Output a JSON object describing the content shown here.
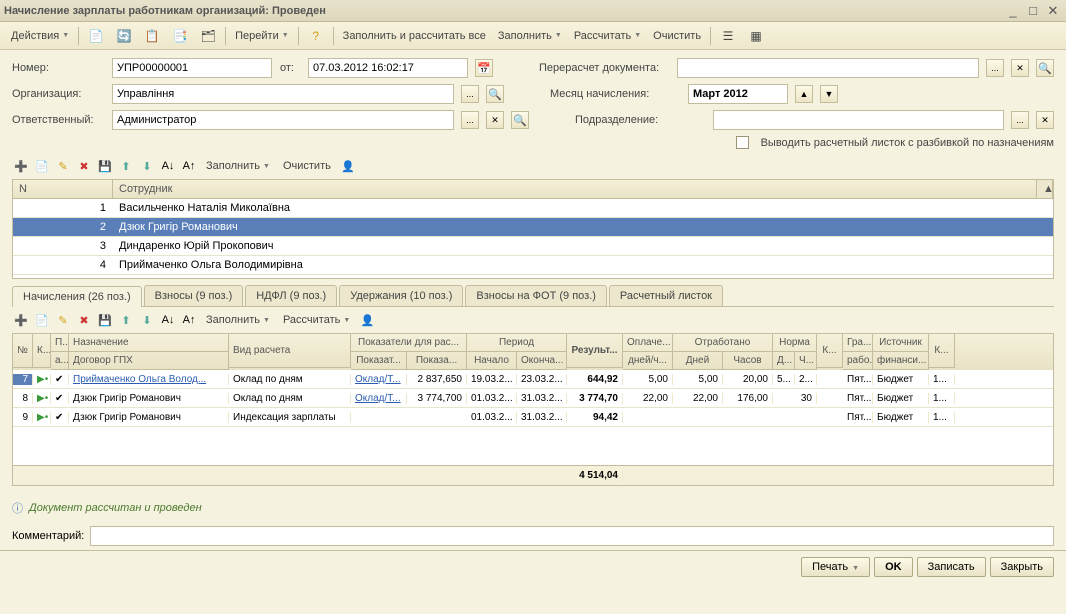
{
  "window_title": "Начисление зарплаты работникам организаций: Проведен",
  "toolbar": {
    "actions": "Действия",
    "go": "Перейти",
    "fill_calc_all": "Заполнить и рассчитать все",
    "fill": "Заполнить",
    "calc": "Рассчитать",
    "clear": "Очистить"
  },
  "form": {
    "number_label": "Номер:",
    "number": "УПР00000001",
    "from_label": "от:",
    "date": "07.03.2012 16:02:17",
    "recalc_label": "Перерасчет документа:",
    "org_label": "Организация:",
    "org": "Управління",
    "month_label": "Месяц начисления:",
    "month": "Март 2012",
    "resp_label": "Ответственный:",
    "resp": "Администратор",
    "dept_label": "Подразделение:",
    "split_label": "Выводить расчетный листок с разбивкой по назначениям"
  },
  "subtb": {
    "fill": "Заполнить",
    "clear": "Очистить"
  },
  "emp_head": {
    "n": "N",
    "emp": "Сотрудник"
  },
  "employees": [
    {
      "n": "1",
      "name": "Васильченко Наталія Миколаївна"
    },
    {
      "n": "2",
      "name": "Дзюк Григір Романович"
    },
    {
      "n": "3",
      "name": "Диндаренко Юрій Прокопович"
    },
    {
      "n": "4",
      "name": "Приймаченко Ольга Володимирівна"
    }
  ],
  "tabs": {
    "t1": "Начисления (26 поз.)",
    "t2": "Взносы (9 поз.)",
    "t3": "НДФЛ (9 поз.)",
    "t4": "Удержания (10 поз.)",
    "t5": "Взносы на ФОТ (9 поз.)",
    "t6": "Расчетный листок"
  },
  "subtb2": {
    "fill": "Заполнить",
    "calc": "Рассчитать"
  },
  "dhead": {
    "n": "№",
    "k": "К...",
    "p": "П...",
    "a": "а...",
    "assign": "Назначение",
    "contract": "Договор ГПХ",
    "calc_type": "Вид расчета",
    "indicators": "Показатели для рас...",
    "i1": "Показат...",
    "i2": "Показа...",
    "period": "Период",
    "start": "Начало",
    "end": "Оконча...",
    "result": "Результ...",
    "paid": "Оплаче...",
    "paid2": "дней/ч...",
    "worked": "Отработано",
    "days": "Дней",
    "hours": "Часов",
    "norm": "Норма",
    "nd": "Д...",
    "nh": "Ч...",
    "kk": "К...",
    "gr": "Гра...",
    "gr2": "рабо...",
    "src": "Источник",
    "src2": "финанси...",
    "kc": "К..."
  },
  "drows": [
    {
      "n": "7",
      "assign": "Приймаченко Ольга Волод...",
      "type": "Оклад по дням",
      "i1": "Оклад/Т...",
      "i2": "2 837,650",
      "start": "19.03.2...",
      "end": "23.03.2...",
      "res": "644,92",
      "paid": "5,00",
      "days": "5,00",
      "hours": "20,00",
      "nd": "5...",
      "nh": "2...",
      "gr": "Пят...",
      "src": "Бюджет",
      "kc": "1..."
    },
    {
      "n": "8",
      "assign": "Дзюк Григір Романович",
      "type": "Оклад по дням",
      "i1": "Оклад/Т...",
      "i2": "3 774,700",
      "start": "01.03.2...",
      "end": "31.03.2...",
      "res": "3 774,70",
      "paid": "22,00",
      "days": "22,00",
      "hours": "176,00",
      "nd": "",
      "nh": "30",
      "gr": "Пят...",
      "src": "Бюджет",
      "kc": "1..."
    },
    {
      "n": "9",
      "assign": "Дзюк Григір Романович",
      "type": "Индексация зарплаты",
      "i1": "",
      "i2": "",
      "start": "01.03.2...",
      "end": "31.03.2...",
      "res": "94,42",
      "paid": "",
      "days": "",
      "hours": "",
      "nd": "",
      "nh": "",
      "gr": "Пят...",
      "src": "Бюджет",
      "kc": "1..."
    }
  ],
  "total": "4 514,04",
  "status": "Документ рассчитан и проведен",
  "comment_label": "Комментарий:",
  "footer": {
    "print": "Печать",
    "ok": "OK",
    "save": "Записать",
    "close": "Закрыть"
  }
}
